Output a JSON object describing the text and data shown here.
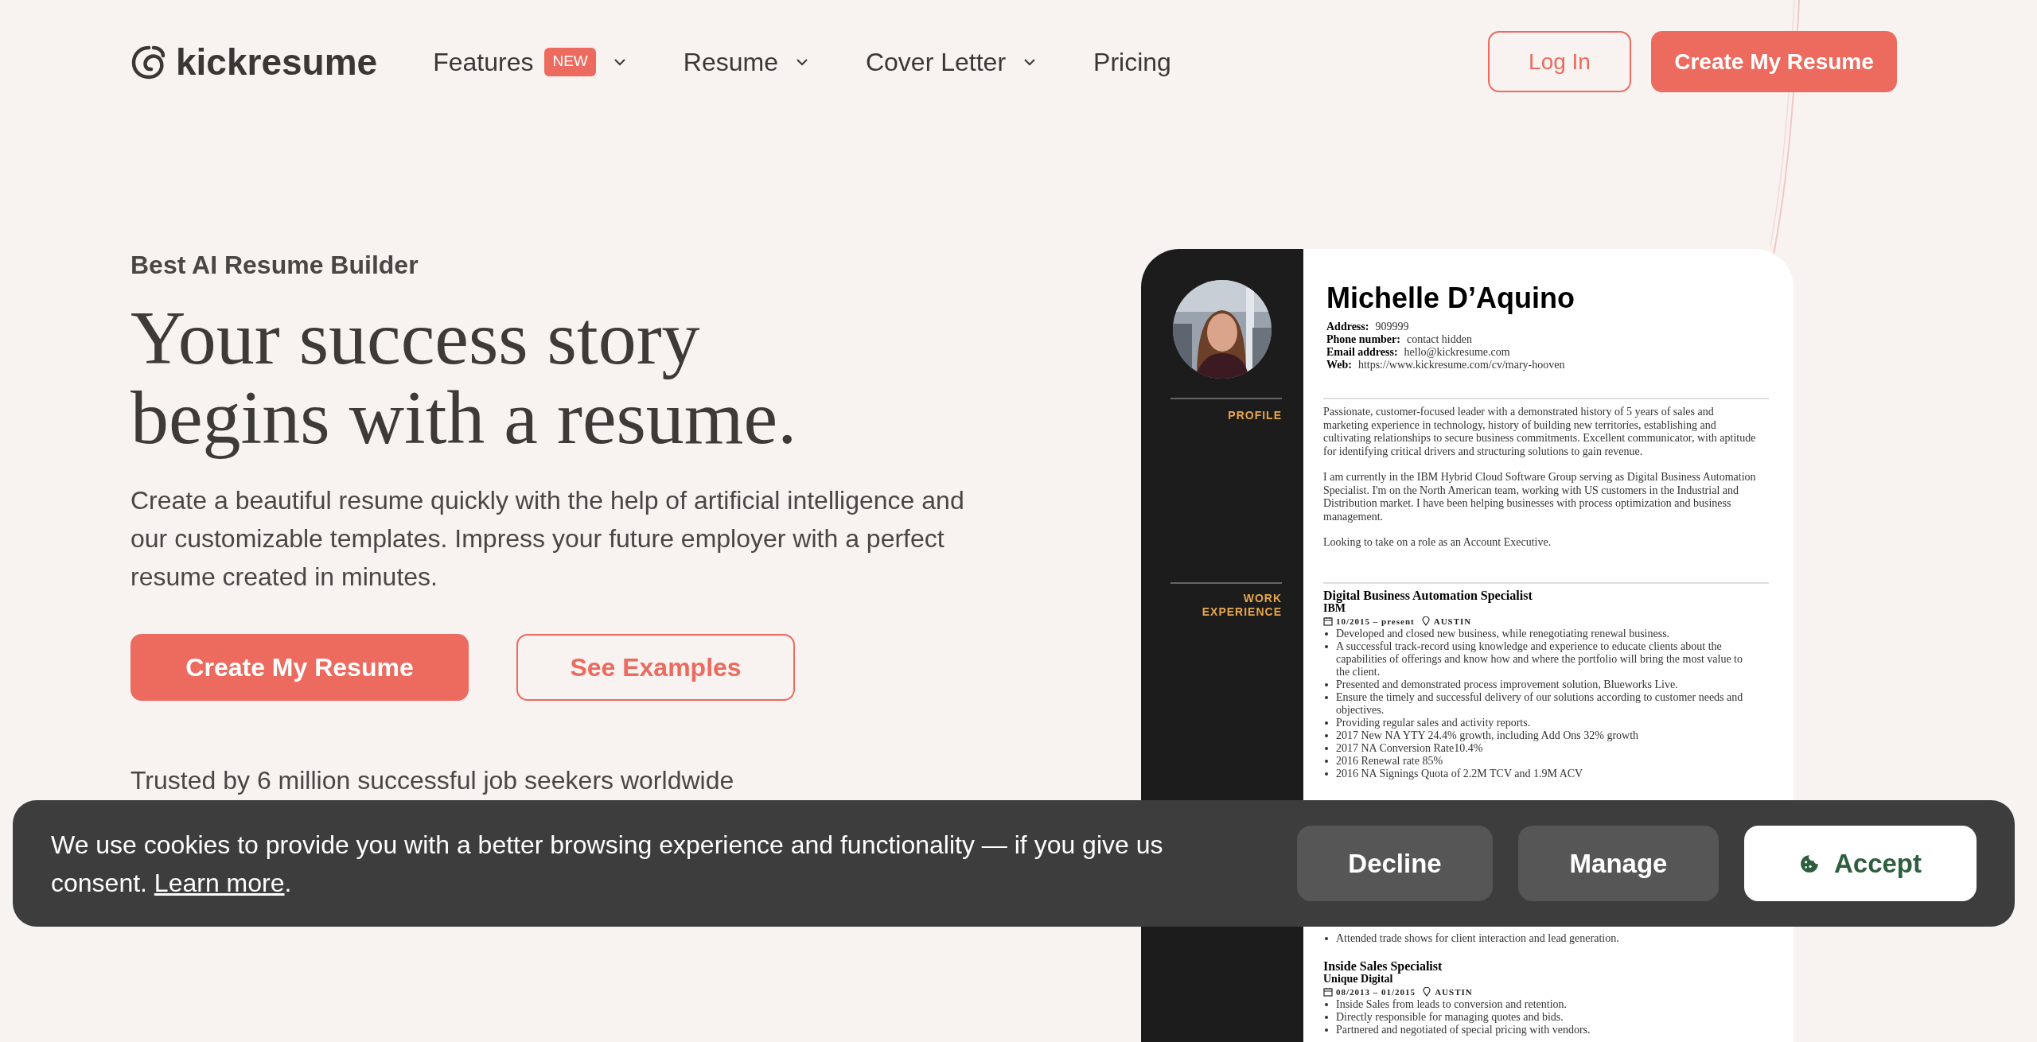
{
  "nav": {
    "logo": "kickresume",
    "items": [
      {
        "label": "Features",
        "badge": "NEW",
        "dropdown": true
      },
      {
        "label": "Resume",
        "dropdown": true
      },
      {
        "label": "Cover Letter",
        "dropdown": true
      },
      {
        "label": "Pricing",
        "dropdown": false
      }
    ],
    "login": "Log In",
    "cta": "Create My Resume"
  },
  "hero": {
    "eyebrow": "Best AI Resume Builder",
    "title": [
      "Your success story",
      "begins with a resume."
    ],
    "text": "Create a beautiful resume quickly with the help of artificial intelligence and our customizable templates. Impress your future employer with a perfect resume created in minutes.",
    "primary": "Create My Resume",
    "secondary": "See Examples",
    "trusted": "Trusted by 6 million successful job seekers worldwide"
  },
  "resume": {
    "name": "Michelle D’Aquino",
    "contacts": [
      {
        "label": "Address:",
        "value": "909999"
      },
      {
        "label": "Phone number:",
        "value": "contact hidden"
      },
      {
        "label": "Email address:",
        "value": "hello@kickresume.com"
      },
      {
        "label": "Web:",
        "value": "https://www.kickresume.com/cv/mary-hooven"
      }
    ],
    "profile_label": "PROFILE",
    "profile": [
      "Passionate, customer-focused leader with a demonstrated history of 5 years of sales and marketing experience in technology, history of building new territories, establishing and cultivating relationships to secure business commitments. Excellent communicator, with aptitude for identifying critical drivers and structuring solutions to gain revenue.",
      "I am currently in the IBM Hybrid Cloud Software Group serving as Digital Business Automation Specialist. I'm on the North American team, working with US customers in the Industrial and Distribution market. I have been helping businesses with process optimization and business management.",
      "Looking to take on a role as an Account Executive."
    ],
    "work_label": "WORK EXPERIENCE",
    "jobs": [
      {
        "title": "Digital Business Automation Specialist",
        "company": "IBM",
        "dates": "10/2015 – present",
        "location": "AUSTIN",
        "bullets": [
          "Developed and closed new business, while renegotiating renewal business.",
          "A successful track-record using knowledge and experience  to educate clients about the capabilities of offerings and know how and where the portfolio will bring the most value to the client.",
          "Presented and demonstrated process improvement solution, Blueworks Live.",
          "Ensure the timely and successful delivery of our solutions according to customer needs and objectives.",
          "Providing regular sales and activity reports.",
          "2017 New NA YTY 24.4% growth, including Add Ons 32% growth",
          "2017 NA Conversion Rate10.4%",
          "2016 Renewal rate 85%",
          "2016 NA Signings Quota of 2.2M TCV and 1.9M ACV"
        ],
        "trailing_bullets": [
          "Attended trade shows for client interaction and lead generation."
        ]
      },
      {
        "title": "Inside Sales Specialist",
        "company": "Unique Digital",
        "dates": "08/2013 – 01/2015",
        "location": "AUSTIN",
        "bullets": [
          "Inside Sales from leads to conversion and retention.",
          "Directly responsible for managing quotes and bids.",
          "Partnered and negotiated of special pricing with vendors."
        ]
      }
    ]
  },
  "cookie": {
    "text": "We use cookies to provide you with a better browsing experience and functionality — if you give us consent.",
    "link": "Learn more",
    "after": ".",
    "buttons": [
      {
        "label": "Decline",
        "kind": "dark"
      },
      {
        "label": "Manage",
        "kind": "dark"
      },
      {
        "label": "Accept",
        "kind": "light"
      }
    ]
  }
}
